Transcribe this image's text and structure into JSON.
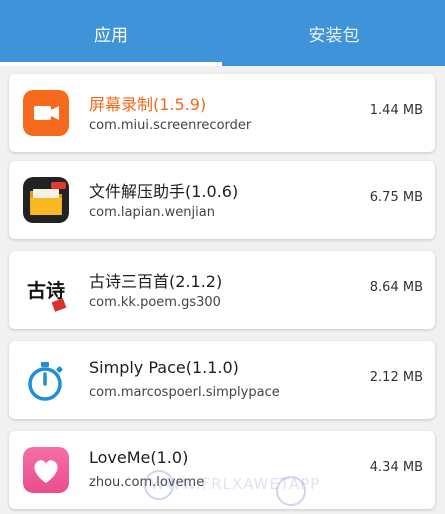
{
  "tabs": [
    {
      "label": "应用",
      "active": true
    },
    {
      "label": "安装包",
      "active": false
    }
  ],
  "colors": {
    "header": "#3f93d8",
    "highlight_text": "#f26a1b",
    "background": "#f1f1f1"
  },
  "apps": [
    {
      "name": "屏幕录制(1.5.9)",
      "package": "com.miui.screenrecorder",
      "size": "1.44 MB",
      "icon": "screen-recorder-icon",
      "highlighted": true
    },
    {
      "name": "文件解压助手(1.0.6)",
      "package": "com.lapian.wenjian",
      "size": "6.75 MB",
      "icon": "folder-unzip-icon",
      "highlighted": false
    },
    {
      "name": "古诗三百首(2.1.2)",
      "package": "com.kk.poem.gs300",
      "size": "8.64 MB",
      "icon": "ancient-poem-icon",
      "highlighted": false
    },
    {
      "name": "Simply Pace(1.1.0)",
      "package": "com.marcospoerl.simplypace",
      "size": "2.12 MB",
      "icon": "stopwatch-icon",
      "highlighted": false
    },
    {
      "name": "LoveMe(1.0)",
      "package": "zhou.com.loveme",
      "size": "4.34 MB",
      "icon": "heart-icon",
      "highlighted": false
    }
  ],
  "watermark": "WWW.FRLXAWETAPP"
}
